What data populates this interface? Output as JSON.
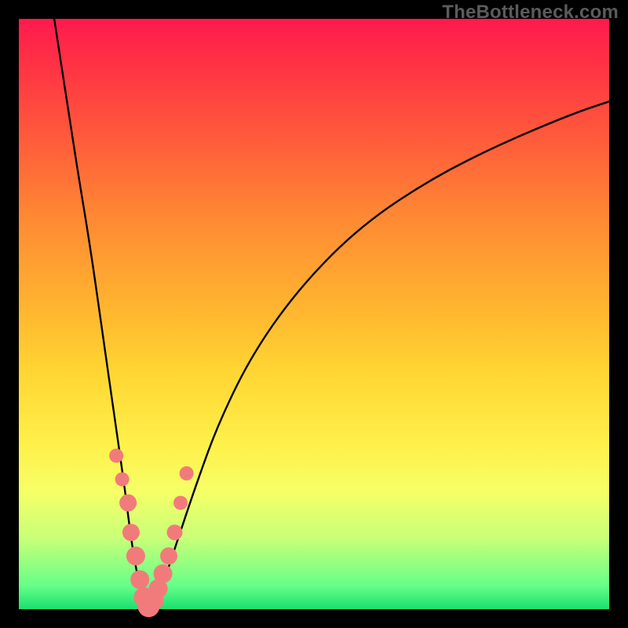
{
  "watermark": "TheBottleneck.com",
  "chart_data": {
    "type": "line",
    "title": "",
    "xlabel": "",
    "ylabel": "",
    "xlim": [
      0,
      100
    ],
    "ylim": [
      0,
      100
    ],
    "grid": false,
    "curve": {
      "name": "bottleneck-curve",
      "x": [
        6,
        8,
        10,
        12,
        14,
        16,
        17,
        18,
        19,
        20,
        21,
        22,
        23,
        24,
        25,
        27,
        30,
        34,
        40,
        48,
        58,
        70,
        82,
        94,
        100
      ],
      "y": [
        100,
        87,
        74,
        62,
        48,
        34,
        27,
        20,
        12,
        6,
        2,
        0,
        1,
        3,
        6,
        12,
        21,
        32,
        44,
        55,
        65,
        73,
        79,
        84,
        86
      ]
    },
    "series": [
      {
        "name": "marker-dots",
        "type": "scatter",
        "color": "#f17b7b",
        "x": [
          16.5,
          17.5,
          18.5,
          19.0,
          19.8,
          20.5,
          21.2,
          22.0,
          22.8,
          23.6,
          24.4,
          25.4,
          26.4,
          27.4,
          28.4
        ],
        "y": [
          26,
          22,
          18,
          13,
          9,
          5,
          2,
          0.5,
          1.5,
          3.5,
          6,
          9,
          13,
          18,
          23
        ],
        "r": [
          9,
          9,
          11,
          11,
          12,
          12,
          13,
          14,
          13,
          12,
          12,
          11,
          10,
          9,
          9
        ]
      }
    ]
  }
}
